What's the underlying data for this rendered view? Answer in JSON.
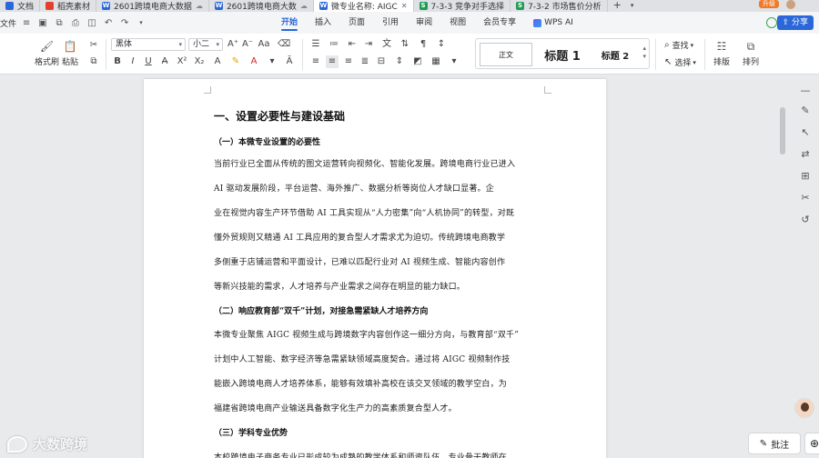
{
  "tabs": [
    {
      "label": "文档",
      "icon": "doc-icon",
      "color": "#2b67d8"
    },
    {
      "label": "稻壳素材",
      "icon": "docer-icon",
      "color": "#e5402c"
    },
    {
      "label": "2601跨境电商大数据",
      "icon": "word-icon",
      "color": "#2b67d8"
    },
    {
      "label": "2601跨境电商大数",
      "icon": "word-icon",
      "color": "#2b67d8"
    },
    {
      "label": "微专业名称: AIGC",
      "icon": "word-icon",
      "color": "#2b67d8"
    },
    {
      "label": "7-3-3 竞争对手选择",
      "icon": "sheet-icon",
      "color": "#1f9d55"
    },
    {
      "label": "7-3-2 市场售价分析",
      "icon": "sheet-icon",
      "color": "#1f9d55"
    }
  ],
  "upgrade_label": "升级",
  "menu": {
    "file": "文件",
    "tabs": [
      "开始",
      "插入",
      "页面",
      "引用",
      "审阅",
      "视图",
      "会员专享"
    ],
    "active_tab": "开始",
    "wps_ai": "WPS AI",
    "share": "分享"
  },
  "ribbon": {
    "format_painter": "格式刷",
    "paste": "粘贴",
    "font_name": "黑体",
    "font_size": "小二",
    "styles": {
      "normal": "正文",
      "h1": "标题 1",
      "h2": "标题 2"
    },
    "find": "查找",
    "select": "选择",
    "layout": "排版",
    "arrange": "排列"
  },
  "document": {
    "h1": "一、设置必要性与建设基础",
    "sec1_title": "（一）本微专业设置的必要性",
    "sec1_lines": [
      "当前行业已全面从传统的图文运营转向视频化、智能化发展。跨境电商行业已进入",
      "AI 驱动发展阶段，平台运营、海外推广、数据分析等岗位人才缺口显著。企",
      "业在视觉内容生产环节借助 AI 工具实现从“人力密集”向“人机协同”的转型，对既",
      "懂外贸规则又精通 AI 工具应用的复合型人才需求尤为迫切。传统跨境电商教学",
      "多侧重于店铺运营和平面设计，已难以匹配行业对 AI 视频生成、智能内容创作",
      "等新兴技能的需求，人才培养与产业需求之间存在明显的能力缺口。"
    ],
    "sec2_title": "（二）响应教育部“双千”计划，对接急需紧缺人才培养方向",
    "sec2_lines": [
      "本微专业聚焦 AIGC 视频生成与跨境数字内容创作这一细分方向，与教育部“双千”",
      "计划中人工智能、数字经济等急需紧缺领域高度契合。通过将 AIGC 视频制作技",
      "能嵌入跨境电商人才培养体系，能够有效填补高校在该交叉领域的教学空白，为",
      "福建省跨境电商产业输送具备数字化生产力的高素质复合型人才。"
    ],
    "sec3_title": "（三）学科专业优势",
    "sec3_lines": [
      "本校跨境电子商务专业已形成较为成熟的教学体系和师资队伍，专业骨干教师在"
    ]
  },
  "comment_button": "批注",
  "watermark": "大数跨境"
}
